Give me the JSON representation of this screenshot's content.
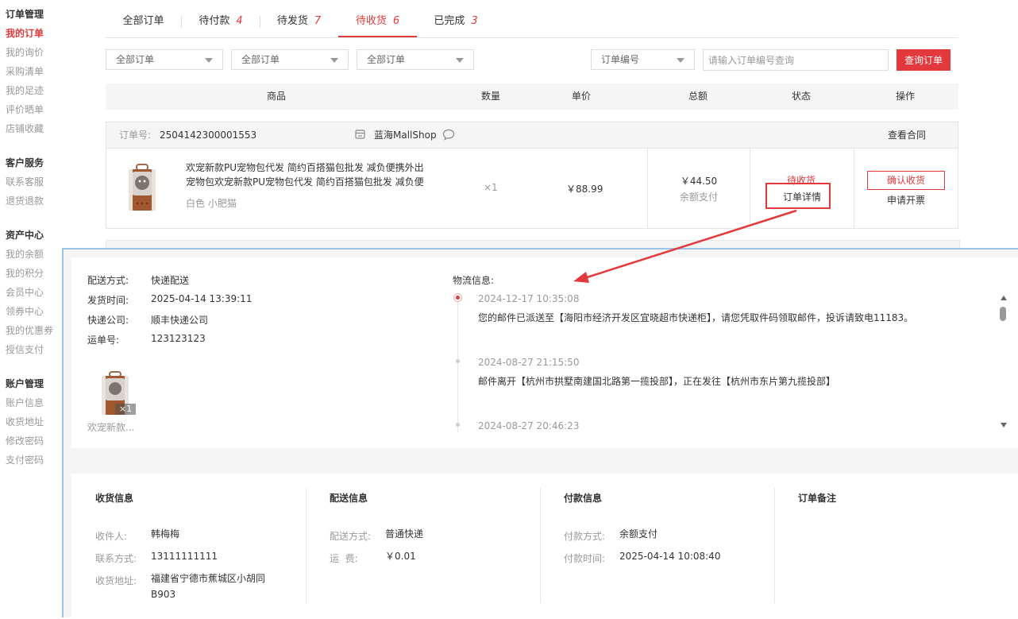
{
  "sidebar": {
    "groups": [
      {
        "title": "订单管理",
        "items": [
          "我的订单",
          "我的询价",
          "采购清单",
          "我的足迹",
          "评价晒单",
          "店铺收藏"
        ]
      },
      {
        "title": "客户服务",
        "items": [
          "联系客服",
          "退货退款"
        ]
      },
      {
        "title": "资产中心",
        "items": [
          "我的余额",
          "我的积分",
          "会员中心",
          "领券中心",
          "我的优惠券",
          "授信支付"
        ]
      },
      {
        "title": "账户管理",
        "items": [
          "账户信息",
          "收货地址",
          "修改密码",
          "支付密码"
        ]
      }
    ],
    "active": "我的订单"
  },
  "tabs": [
    {
      "label": "全部订单",
      "count": ""
    },
    {
      "label": "待付款",
      "count": "4"
    },
    {
      "label": "待发货",
      "count": "7"
    },
    {
      "label": "待收货",
      "count": "6"
    },
    {
      "label": "已完成",
      "count": "3"
    }
  ],
  "active_tab": "待收货",
  "filters": {
    "select1": "全部订单",
    "select2": "全部订单",
    "select3": "全部订单",
    "search_type": "订单编号",
    "search_placeholder": "请输入订单编号查询",
    "search_button": "查询订单"
  },
  "table_header": [
    "商品",
    "数量",
    "单价",
    "总额",
    "状态",
    "操作"
  ],
  "order": {
    "number_label": "订单号:",
    "number": "2504142300001553",
    "shop": "蓝海MallShop",
    "contract": "查看合同",
    "product_title": "欢宠新款PU宠物包代发 简约百搭猫包批发 减负便携外出宠物包欢宠新款PU宠物包代发 简约百搭猫包批发 减负便",
    "spec": "白色 小肥猫",
    "quantity": "×1",
    "unit_price": "￥88.99",
    "total": "￥44.50",
    "pay_type": "余额支付",
    "status": "待收货",
    "detail": "订单详情",
    "confirm": "确认收货",
    "invoice": "申请开票"
  },
  "shipping": {
    "method_label": "配送方式:",
    "method": "快递配送",
    "time_label": "发货时间:",
    "time": "2025-04-14 13:39:11",
    "company_label": "快递公司:",
    "company": "顺丰快递公司",
    "waybill_label": "运单号:",
    "waybill": "123123123",
    "item_badge": "×1",
    "item_name": "欢宠新款..."
  },
  "logistics": {
    "label": "物流信息:",
    "events": [
      {
        "time": "2024-12-17 10:35:08",
        "desc": "您的邮件已派送至【海阳市经济开发区宜晓超市快递柜】，请您凭取件码领取邮件，投诉请致电11183。"
      },
      {
        "time": "2024-08-27 21:15:50",
        "desc": "邮件离开【杭州市拱墅南建国北路第一揽投部】，正在发往【杭州市东片第九揽投部】"
      },
      {
        "time": "2024-08-27 20:46:23",
        "desc": ""
      }
    ]
  },
  "info": {
    "receive": {
      "title": "收货信息",
      "rows": [
        {
          "k": "收件人:",
          "v": "韩梅梅"
        },
        {
          "k": "联系方式:",
          "v": "13111111111"
        },
        {
          "k": "收货地址:",
          "v": "福建省宁德市蕉城区小胡同B903"
        }
      ]
    },
    "delivery": {
      "title": "配送信息",
      "rows": [
        {
          "k": "配送方式:",
          "v": "普通快递"
        },
        {
          "k": "运  费:",
          "v": "￥0.01"
        }
      ]
    },
    "payment": {
      "title": "付款信息",
      "rows": [
        {
          "k": "付款方式:",
          "v": "余额支付"
        },
        {
          "k": "付款时间:",
          "v": "2025-04-14 10:08:40"
        }
      ]
    },
    "remark": {
      "title": "订单备注"
    }
  },
  "colors": {
    "accent": "#e4393c",
    "muted": "#999999",
    "popup_border": "#9cc3e8"
  }
}
